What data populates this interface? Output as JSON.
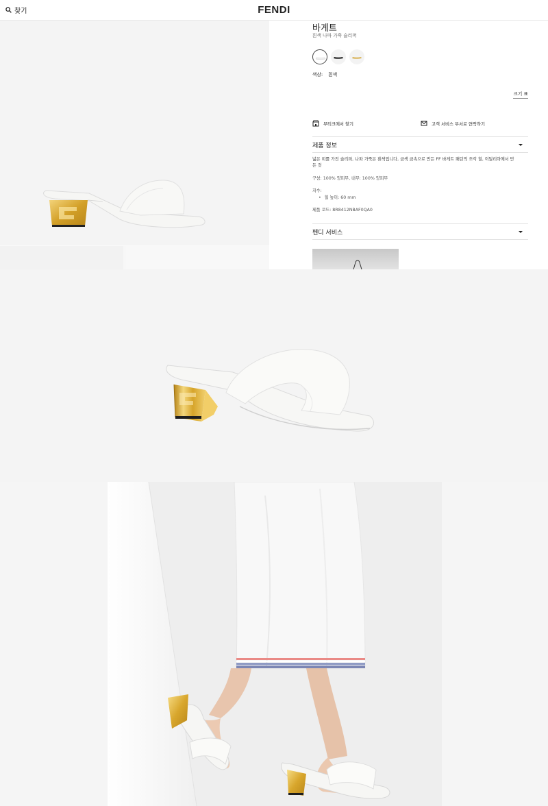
{
  "header": {
    "search_label": "찾기",
    "logo": "FENDI"
  },
  "product": {
    "title": "바게트",
    "subtitle": "흰색 나파 가죽 슬리퍼",
    "color_label": "색상:",
    "color_value": "흰색",
    "size_chart": "크기 표",
    "swatches": [
      "white",
      "black",
      "gold"
    ]
  },
  "actions": {
    "boutique": "부티크에서 찾기",
    "contact": "고객 서비스 부서로 연락하기"
  },
  "info_section": {
    "heading": "제품 정보",
    "description": "넓은 띠를 가진 슬리퍼, 나파 가죽은 흰색입니다, 금색 금속으로 만든 FF 바게트 패턴의 조각 힐, 이탈리아에서 만든 것",
    "composition": "구성: 100% 양피부, 내부: 100% 양피부",
    "dimensions_label": "치수:",
    "heel_height": "힐 높이: 60 mm",
    "product_code": "제품 코드: 8R8412NBAF0QA0"
  },
  "service_section": {
    "heading": "펜디 서비스"
  },
  "colors": {
    "gold": "#d9a934",
    "white_leather": "#f7f7f5",
    "text": "#222222"
  }
}
